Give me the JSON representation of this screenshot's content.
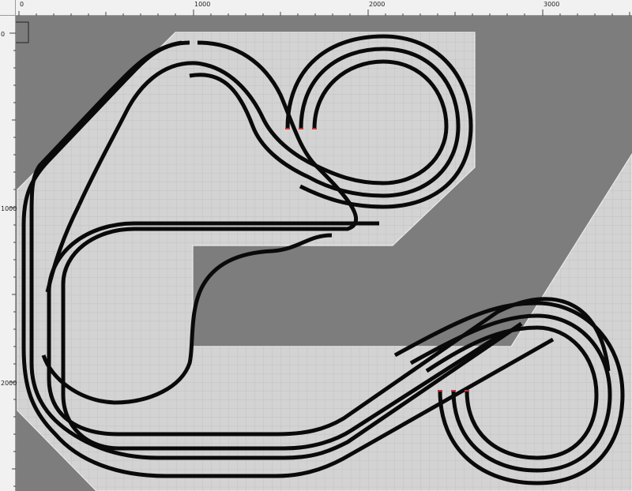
{
  "window": {
    "title": ""
  },
  "ruler": {
    "x_labels": [
      "0",
      "1000",
      "2000",
      "3000"
    ],
    "y_labels": [
      "0",
      "1000",
      "2000"
    ]
  },
  "colors": {
    "background": "#7d7d7d",
    "board": "#d3d3d3",
    "grid": "#b9b9b9",
    "track": "#0a0a0a",
    "track_end": "#c8302c",
    "ruler": "#f1f1f1"
  },
  "layout_objects": {
    "board_label": "",
    "track_label": ""
  }
}
